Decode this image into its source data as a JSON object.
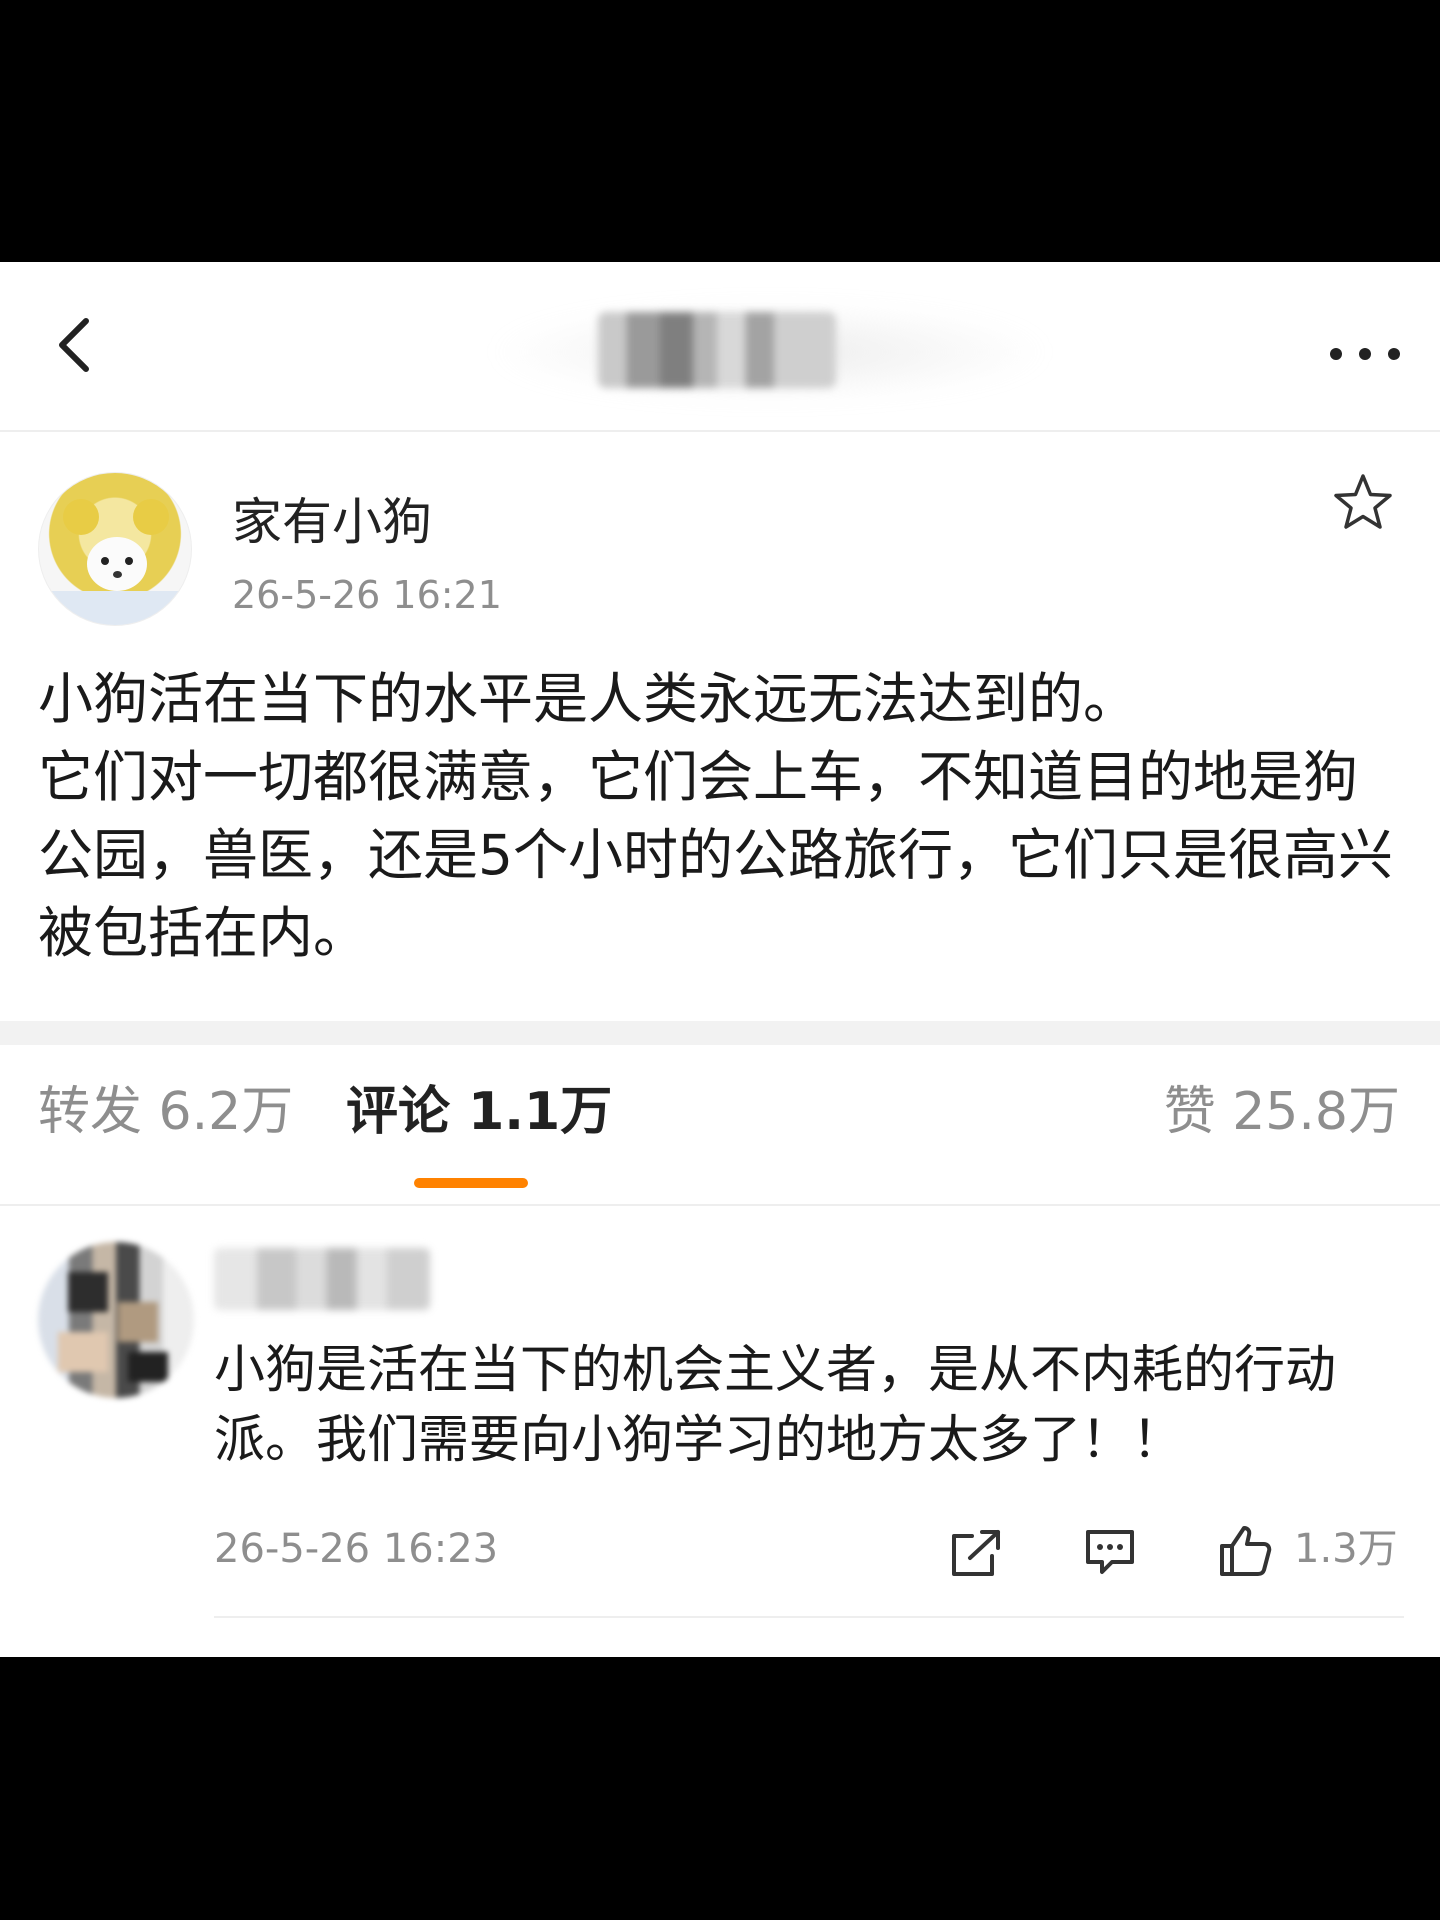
{
  "header": {
    "title": "",
    "back_icon": "chevron-left-icon",
    "more_icon": "more-horizontal-icon"
  },
  "post": {
    "author": "家有小狗",
    "time": "26-5-26 16:21",
    "body": "小狗活在当下的水平是人类永远无法达到的。\n它们对一切都很满意，它们会上车，不知道目的地是狗公园，兽医，还是5个小时的公路旅行，它们只是很高兴被包括在内。",
    "favorite_icon": "star-outline-icon"
  },
  "tabs": {
    "repost": "转发 6.2万",
    "comment": "评论 1.1万",
    "like": "赞 25.8万",
    "active_color": "#ff8200"
  },
  "comment": {
    "body": "小狗是活在当下的机会主义者，是从不内耗的行动派。我们需要向小狗学习的地方太多了！！",
    "time": "26-5-26 16:23",
    "like_count": "1.3万",
    "icons": [
      "share-icon",
      "reply-icon",
      "thumbs-up-icon"
    ]
  }
}
